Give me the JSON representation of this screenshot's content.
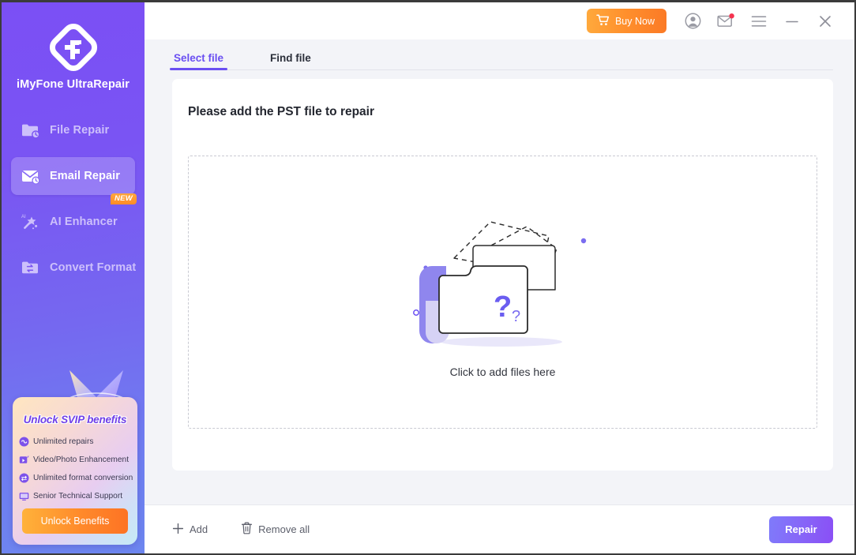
{
  "sidebar": {
    "brand": "iMyFone UltraRepair",
    "logo_icon": "imyfone-logo-icon",
    "items": [
      {
        "label": "File Repair",
        "icon": "folder-clock-icon",
        "active": false,
        "badge": null
      },
      {
        "label": "Email Repair",
        "icon": "envelope-clock-icon",
        "active": true,
        "badge": null
      },
      {
        "label": "AI Enhancer",
        "icon": "ai-wand-icon",
        "active": false,
        "badge": "NEW"
      },
      {
        "label": "Convert Format",
        "icon": "folder-convert-icon",
        "active": false,
        "badge": null
      }
    ],
    "promo": {
      "title": "Unlock SVIP benefits",
      "benefits": [
        {
          "text": "Unlimited repairs",
          "icon": "infinity-badge-icon"
        },
        {
          "text": "Video/Photo Enhancement",
          "icon": "video-play-icon"
        },
        {
          "text": "Unlimited format conversion",
          "icon": "convert-badge-icon"
        },
        {
          "text": "Senior Technical Support",
          "icon": "monitor-support-icon"
        }
      ],
      "button_label": "Unlock Benefits"
    }
  },
  "titlebar": {
    "buy_now_label": "Buy Now",
    "cart_icon": "shopping-cart-icon",
    "account_icon": "account-avatar-icon",
    "mail_icon": "mail-notification-icon",
    "menu_icon": "hamburger-menu-icon",
    "minimize_icon": "minimize-icon",
    "close_icon": "close-icon"
  },
  "tabs": [
    {
      "label": "Select file",
      "active": true
    },
    {
      "label": "Find file",
      "active": false
    }
  ],
  "main": {
    "panel_title": "Please add the PST file to repair",
    "dropzone_caption": "Click to add files here",
    "dropzone_icon": "empty-folder-question-illustration"
  },
  "footer": {
    "add_label": "Add",
    "add_icon": "plus-icon",
    "remove_all_label": "Remove all",
    "remove_all_icon": "trash-icon",
    "repair_label": "Repair"
  },
  "colors": {
    "brand_purple": "#6a4ff2",
    "sidebar_gradient_start": "#7b4ff5",
    "sidebar_gradient_end": "#6d86ef",
    "accent_orange": "#ff8f2c",
    "panel_bg": "#ffffff",
    "content_bg": "#f3f4f8",
    "text_dark": "#23262f",
    "nav_inactive": "#cdc0fb",
    "dashed_border": "#c9cad2"
  }
}
